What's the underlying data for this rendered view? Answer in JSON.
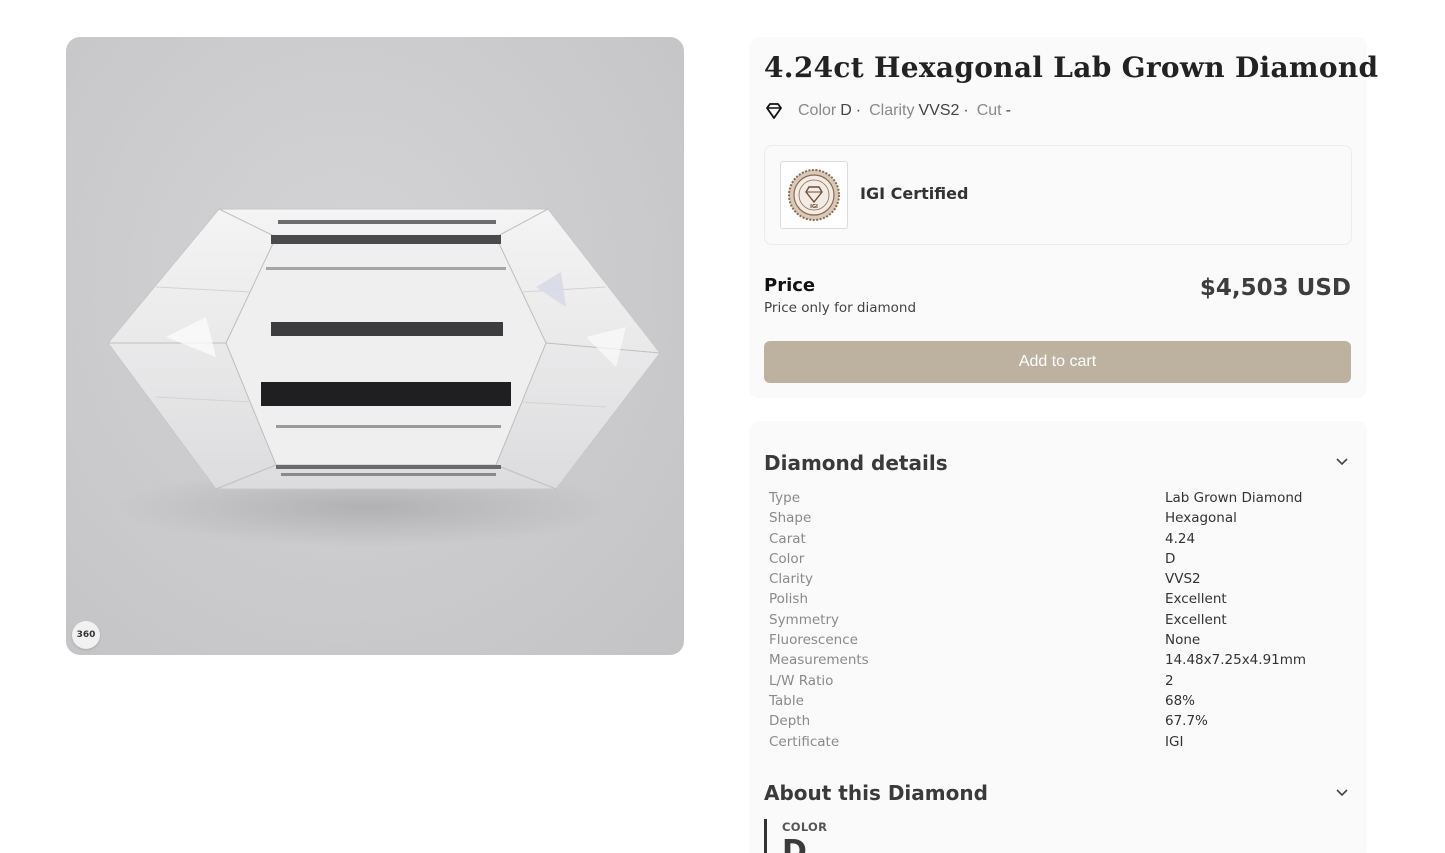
{
  "product": {
    "title": "4.24ct Hexagonal Lab Grown Diamond",
    "view_360_label": "360"
  },
  "specs": {
    "color_label": "Color",
    "color_value": "D",
    "clarity_label": "Clarity",
    "clarity_value": "VVS2",
    "cut_label": "Cut",
    "cut_value": "-",
    "separator": "·"
  },
  "certificate": {
    "label": "IGI Certified",
    "seal_text": "IGI"
  },
  "price": {
    "label": "Price",
    "note": "Price only for diamond",
    "value": "$4,503 USD"
  },
  "cart": {
    "button_label": "Add to cart"
  },
  "details": {
    "title": "Diamond details",
    "rows": [
      {
        "key": "Type",
        "value": "Lab Grown Diamond"
      },
      {
        "key": "Shape",
        "value": "Hexagonal"
      },
      {
        "key": "Carat",
        "value": "4.24"
      },
      {
        "key": "Color",
        "value": "D"
      },
      {
        "key": "Clarity",
        "value": "VVS2"
      },
      {
        "key": "Polish",
        "value": "Excellent"
      },
      {
        "key": "Symmetry",
        "value": "Excellent"
      },
      {
        "key": "Fluorescence",
        "value": "None"
      },
      {
        "key": "Measurements",
        "value": "14.48x7.25x4.91mm"
      },
      {
        "key": "L/W Ratio",
        "value": "2"
      },
      {
        "key": "Table",
        "value": "68%"
      },
      {
        "key": "Depth",
        "value": "67.7%"
      },
      {
        "key": "Certificate",
        "value": "IGI"
      }
    ]
  },
  "about": {
    "title": "About this Diamond",
    "color_label": "COLOR",
    "color_value": "D"
  },
  "colors": {
    "button": "#bdb29f",
    "card_bg": "#fafafa",
    "media_bg": "#cbcbcd"
  },
  "icons": {
    "spec": "diamond-outline-icon",
    "expand": "chevron-down-icon",
    "view360": "360-view-icon",
    "seal": "igi-seal-icon"
  }
}
